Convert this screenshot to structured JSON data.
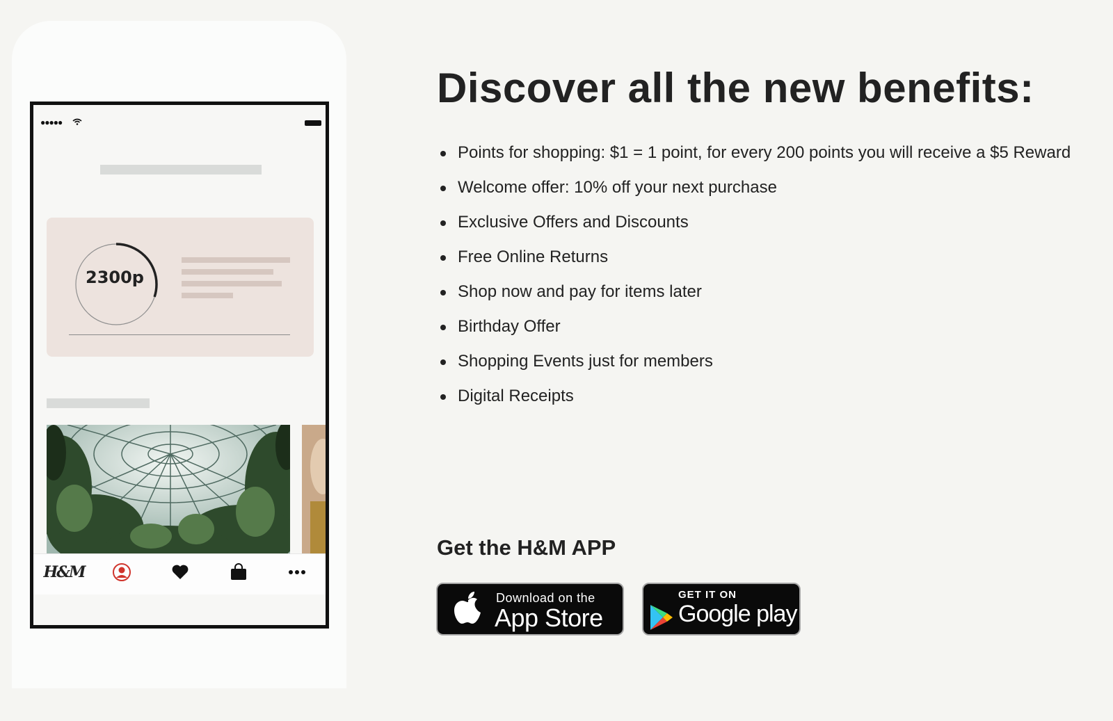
{
  "phone_mockup": {
    "points_value": "2300p",
    "points_progress_fraction": 0.3,
    "logo_text": "H&M",
    "tab_icons": [
      "hm-logo",
      "profile-icon",
      "heart-icon",
      "bag-icon",
      "more-icon"
    ]
  },
  "benefits": {
    "title": "Discover all the new benefits:",
    "items": [
      "Points for shopping: $1 = 1 point, for every 200 points you will receive a $5 Reward",
      "Welcome offer: 10% off your next purchase",
      "Exclusive Offers and Discounts",
      "Free Online Returns",
      "Shop now and pay for items later",
      "Birthday Offer",
      "Shopping Events just for members",
      "Digital Receipts"
    ]
  },
  "app": {
    "heading": "Get the H&M APP",
    "app_store": {
      "small": "Download on the",
      "big": "App Store"
    },
    "google_play": {
      "small": "GET IT ON",
      "big": "Google play"
    }
  },
  "colors": {
    "page_background": "#f5f5f2",
    "points_card": "#ede3de",
    "profile_accent": "#d0342c",
    "button_background": "#0a0a0a"
  }
}
